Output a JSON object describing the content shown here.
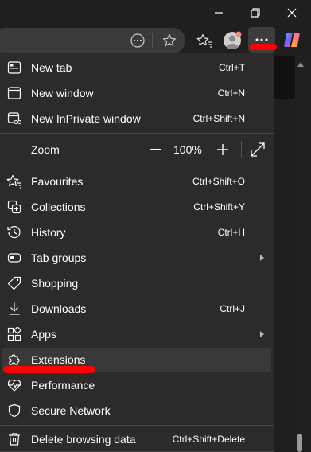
{
  "menu": {
    "items": [
      {
        "label": "New tab",
        "shortcut": "Ctrl+T",
        "icon": "new-tab-icon"
      },
      {
        "label": "New window",
        "shortcut": "Ctrl+N",
        "icon": "new-window-icon"
      },
      {
        "label": "New InPrivate window",
        "shortcut": "Ctrl+Shift+N",
        "icon": "inprivate-icon"
      }
    ],
    "zoom": {
      "label": "Zoom",
      "value": "100%"
    },
    "items2": [
      {
        "label": "Favourites",
        "shortcut": "Ctrl+Shift+O",
        "icon": "favourites-icon"
      },
      {
        "label": "Collections",
        "shortcut": "Ctrl+Shift+Y",
        "icon": "collections-icon"
      },
      {
        "label": "History",
        "shortcut": "Ctrl+H",
        "icon": "history-icon"
      },
      {
        "label": "Tab groups",
        "shortcut": "",
        "icon": "tab-groups-icon"
      },
      {
        "label": "Shopping",
        "shortcut": "",
        "icon": "shopping-tag-icon"
      },
      {
        "label": "Downloads",
        "shortcut": "Ctrl+J",
        "icon": "download-icon"
      },
      {
        "label": "Apps",
        "shortcut": "",
        "icon": "apps-icon"
      },
      {
        "label": "Extensions",
        "shortcut": "",
        "icon": "puzzle-icon"
      },
      {
        "label": "Performance",
        "shortcut": "",
        "icon": "heartbeat-icon"
      },
      {
        "label": "Secure Network",
        "shortcut": "",
        "icon": "shield-icon"
      }
    ],
    "items3": [
      {
        "label": "Delete browsing data",
        "shortcut": "Ctrl+Shift+Delete",
        "icon": "trash-icon"
      }
    ]
  },
  "colors": {
    "menu_bg": "#2b2b2b",
    "highlight": "#393939",
    "annotation": "#ff0000",
    "avatar_badge": "#f28b82"
  }
}
